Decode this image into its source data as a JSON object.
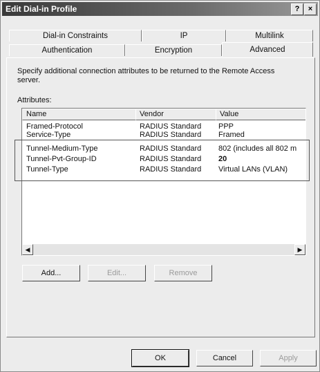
{
  "window": {
    "title": "Edit Dial-in Profile",
    "help_button": "?",
    "close_button": "×"
  },
  "tabs": {
    "row1": [
      "Dial-in Constraints",
      "IP",
      "Multilink"
    ],
    "row2": [
      "Authentication",
      "Encryption",
      "Advanced"
    ],
    "active": "Advanced"
  },
  "advanced": {
    "description": "Specify additional connection attributes to be returned to the Remote Access server.",
    "attributes_label": "Attributes:",
    "columns": [
      "Name",
      "Vendor",
      "Value"
    ],
    "rows": [
      {
        "name": "Framed-Protocol",
        "vendor": "RADIUS Standard",
        "value": "PPP"
      },
      {
        "name": "Service-Type",
        "vendor": "RADIUS Standard",
        "value": "Framed"
      },
      {
        "name": "Tunnel-Medium-Type",
        "vendor": "RADIUS Standard",
        "value": "802 (includes all 802 m"
      },
      {
        "name": "Tunnel-Pvt-Group-ID",
        "vendor": "RADIUS Standard",
        "value": "20"
      },
      {
        "name": "Tunnel-Type",
        "vendor": "RADIUS Standard",
        "value": "Virtual LANs (VLAN)"
      }
    ],
    "buttons": {
      "add": "Add...",
      "edit": "Edit...",
      "remove": "Remove"
    }
  },
  "footer": {
    "ok": "OK",
    "cancel": "Cancel",
    "apply": "Apply"
  }
}
